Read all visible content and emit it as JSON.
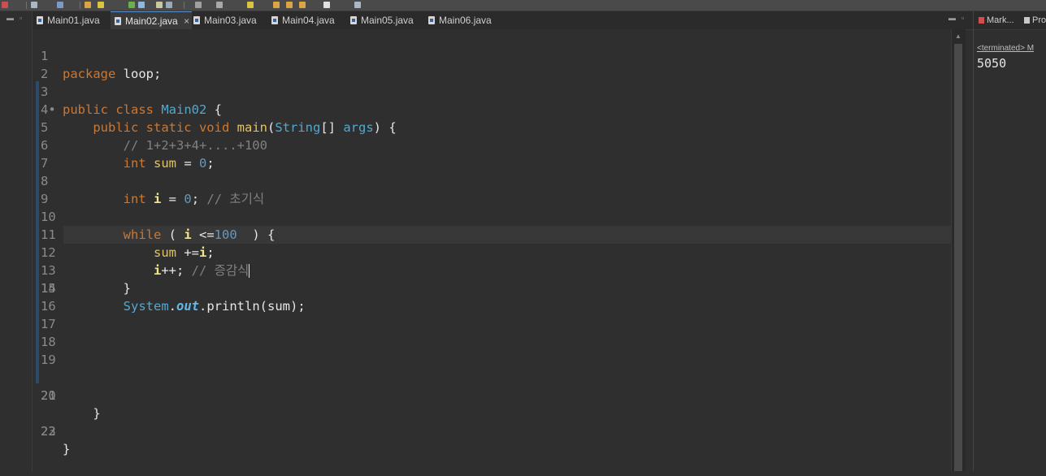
{
  "editor": {
    "tabs": [
      {
        "label": "Main01.java",
        "active": false
      },
      {
        "label": "Main02.java",
        "active": true,
        "close": "×"
      },
      {
        "label": "Main03.java",
        "active": false
      },
      {
        "label": "Main04.java",
        "active": false
      },
      {
        "label": "Main05.java",
        "active": false
      },
      {
        "label": "Main06.java",
        "active": false
      }
    ],
    "line_numbers": [
      "1",
      "2",
      "3",
      "4•",
      "5",
      "6",
      "7",
      "8",
      "9",
      "10",
      "11",
      "12",
      "13",
      "14",
      "15",
      "16",
      "17",
      "18",
      "19",
      "20",
      "21",
      "22",
      "23"
    ],
    "code": {
      "l1_kw": "package",
      "l1_rest": " loop;",
      "l3_kw": "public class",
      "l3_cls": "Main02",
      "l3_rest": " {",
      "l4_kw": "public static void",
      "l4_fn": "main",
      "l4_p1": "(",
      "l4_type": "String",
      "l4_p2": "[] ",
      "l4_arg": "args",
      "l4_p3": ") {",
      "l5_cmt": "// 1+2+3+4+....+100",
      "l6_kw": "int",
      "l6_var": "sum",
      "l6_op": " = ",
      "l6_num": "0",
      "l6_end": ";",
      "l8_kw": "int",
      "l8_var": "i",
      "l8_op": " = ",
      "l8_num": "0",
      "l8_end": "; ",
      "l8_cmt": "// 초기식",
      "l10_kw": "while",
      "l10_p1": " ( ",
      "l10_var": "i",
      "l10_op": " <=",
      "l10_num": "100",
      "l10_p2": "  ) {",
      "l11_var": "sum",
      "l11_op": " +=",
      "l11_var2": "i",
      "l11_end": ";",
      "l12_var": "i",
      "l12_op": "++; ",
      "l12_cmt": "// 증감식",
      "l13": "}",
      "l14_cls": "System",
      "l14_dot": ".",
      "l14_field": "out",
      "l14_rest": ".println(sum);",
      "l20": "}",
      "l22": "}"
    }
  },
  "right_panel": {
    "tabs": [
      "Mark...",
      "Pro"
    ],
    "console_status": "<terminated> M",
    "console_output": "5050"
  }
}
